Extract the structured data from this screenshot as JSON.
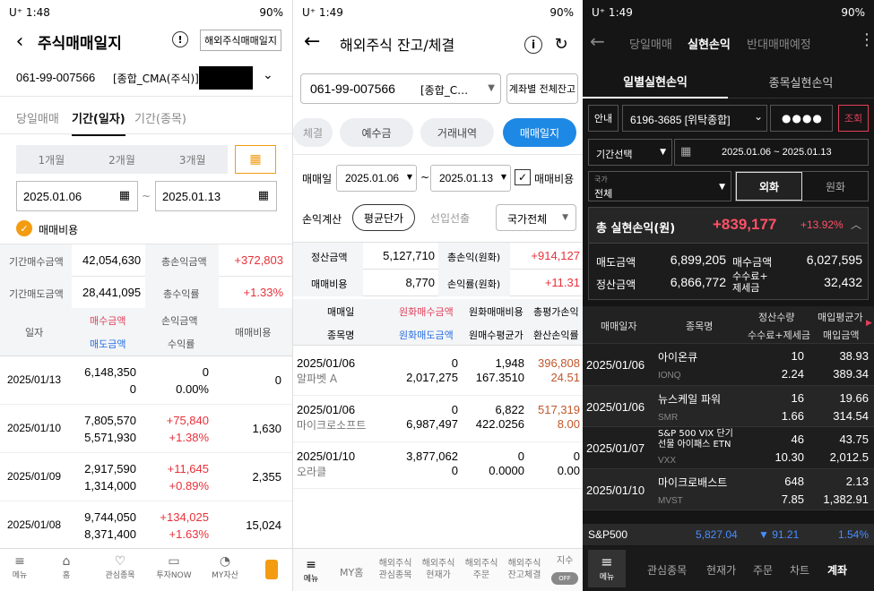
{
  "colors": {
    "accent": "#1e88e5",
    "orange": "#f39c12",
    "red": "#e8303a",
    "dark": "#151515"
  },
  "p1": {
    "status": {
      "left": "U⁺ 1:48",
      "right": "90%"
    },
    "title": "주식매매일지",
    "overseas_btn": "해외주식매매일지",
    "account": "061-99-007566",
    "account_type": "[종합_CMA(주식)]",
    "tabs": [
      "당일매매",
      "기간(일자)",
      "기간(종목)"
    ],
    "periods": [
      "1개월",
      "2개월",
      "3개월"
    ],
    "date_from": "2025.01.06",
    "date_sep": "~",
    "date_to": "2025.01.13",
    "fee_label": "매매비용",
    "summary": [
      {
        "l1": "기간매수금액",
        "v1": "42,054,630",
        "l2": "총손익금액",
        "v2": "+372,803"
      },
      {
        "l1": "기간매도금액",
        "v1": "28,441,095",
        "l2": "총수익률",
        "v2": "+1.33%"
      }
    ],
    "headers": {
      "date": "일자",
      "buy": "매수금액",
      "sell": "매도금액",
      "pl": "손익금액",
      "rate": "수익률",
      "fee": "매매비용"
    },
    "rows": [
      {
        "date": "2025/01/13",
        "buy": "6,148,350",
        "sell": "0",
        "pl": "0",
        "rate": "0.00%",
        "fee": "0"
      },
      {
        "date": "2025/01/10",
        "buy": "7,805,570",
        "sell": "5,571,930",
        "pl": "+75,840",
        "rate": "+1.38%",
        "fee": "1,630"
      },
      {
        "date": "2025/01/09",
        "buy": "2,917,590",
        "sell": "1,314,000",
        "pl": "+11,645",
        "rate": "+0.89%",
        "fee": "2,355"
      },
      {
        "date": "2025/01/08",
        "buy": "9,744,050",
        "sell": "8,371,400",
        "pl": "+134,025",
        "rate": "+1.63%",
        "fee": "15,024"
      }
    ],
    "nav": [
      "메뉴",
      "홈",
      "관심종목",
      "투자NOW",
      "MY자산"
    ]
  },
  "p2": {
    "status": {
      "left": "U⁺ 1:49",
      "right": "90%"
    },
    "title": "해외주식 잔고/체결",
    "account": "061-99-007566",
    "account_type": "[종합_C…",
    "account_btn": "계좌별 전체잔고",
    "tabs": [
      "체결",
      "예수금",
      "거래내역",
      "매매일지"
    ],
    "trade_label": "매매일",
    "date_from": "2025.01.06",
    "date_sep": "~",
    "date_to": "2025.01.13",
    "fee_label": "매매비용",
    "pl_label": "손익계산",
    "pl_options": [
      "평균단가",
      "선입선출"
    ],
    "country": "국가전체",
    "summary": [
      {
        "l1": "정산금액",
        "v1": "5,127,710",
        "l2": "총손익(원화)",
        "v2": "+914,127"
      },
      {
        "l1": "매매비용",
        "v1": "8,770",
        "l2": "손익률(원화)",
        "v2": "+11.31"
      }
    ],
    "headers": {
      "h1": "매매일",
      "h2": "원화매수금액",
      "h3": "원화매매비용",
      "h4": "총평가손익",
      "h5": "종목명",
      "h6": "원화매도금액",
      "h7": "원매수평균가",
      "h8": "환산손익률"
    },
    "rows": [
      {
        "date": "2025/01/06",
        "name": "알파벳 A",
        "buy": "0",
        "sell": "2,017,275",
        "fee": "1,948",
        "avg": "167.3510",
        "pl": "396,808",
        "rate": "24.51"
      },
      {
        "date": "2025/01/06",
        "name": "마이크로소프트",
        "buy": "0",
        "sell": "6,987,497",
        "fee": "6,822",
        "avg": "422.0256",
        "pl": "517,319",
        "rate": "8.00"
      },
      {
        "date": "2025/01/10",
        "name": "오라클",
        "buy": "3,877,062",
        "sell": "0",
        "fee": "0",
        "avg": "0.0000",
        "pl": "0",
        "rate": "0.00"
      }
    ],
    "nav": [
      "메뉴",
      "MY홈",
      "해외주식\n관심종목",
      "해외주식\n현재가",
      "해외주식\n주문",
      "해외주식\n잔고체결",
      "지수"
    ],
    "toggle": "OFF"
  },
  "p3": {
    "status": {
      "left": "U⁺ 1:49",
      "right": "90%"
    },
    "top_tabs": [
      "당일매매",
      "실현손익",
      "반대매매예정"
    ],
    "sub_tabs": [
      "일별실현손익",
      "종목실현손익"
    ],
    "guide": "안내",
    "account": "6196-3685 [위탁종합]",
    "password": "●●●●",
    "search_btn": "조회",
    "period_sel": "기간선택",
    "period": "2025.01.06 ~ 2025.01.13",
    "country_lbl": "국가",
    "country_val": "전체",
    "currency": [
      "외화",
      "원화"
    ],
    "total_label": "총 실현손익(원)",
    "total_value": "+839,177",
    "total_rate": "+13.92%",
    "summary": [
      {
        "l1": "매도금액",
        "v1": "6,899,205",
        "l2": "매수금액",
        "v2": "6,027,595"
      },
      {
        "l1": "정산금액",
        "v1": "6,866,772",
        "l2": "수수료+\n제세금",
        "v2": "32,432"
      }
    ],
    "headers": {
      "date": "매매일자",
      "name": "종목명",
      "qty": "정산수량",
      "fee": "수수료+제세금",
      "avg": "매입평균가",
      "buyamt": "매입금액"
    },
    "rows": [
      {
        "date": "2025/01/06",
        "name": "아이온큐",
        "code": "IONQ",
        "qty": "10",
        "fee": "2.24",
        "avg": "38.93",
        "amt": "389.34"
      },
      {
        "date": "2025/01/06",
        "name": "뉴스케일 파워",
        "code": "SMR",
        "qty": "16",
        "fee": "1.66",
        "avg": "19.66",
        "amt": "314.54"
      },
      {
        "date": "2025/01/07",
        "name": "S&P 500 VIX 단기\n선물 아이패스 ETN",
        "code": "VXX",
        "qty": "46",
        "fee": "10.30",
        "avg": "43.75",
        "amt": "2,012.5"
      },
      {
        "date": "2025/01/10",
        "name": "마이크로배스트",
        "code": "MVST",
        "qty": "648",
        "fee": "7.85",
        "avg": "2.13",
        "amt": "1,382.91"
      }
    ],
    "ticker": {
      "name": "S&P500",
      "value": "5,827.04",
      "change": "▼ 91.21",
      "rate": "1.54%"
    },
    "nav": [
      "메뉴",
      "관심종목",
      "현재가",
      "주문",
      "차트",
      "계좌"
    ]
  }
}
